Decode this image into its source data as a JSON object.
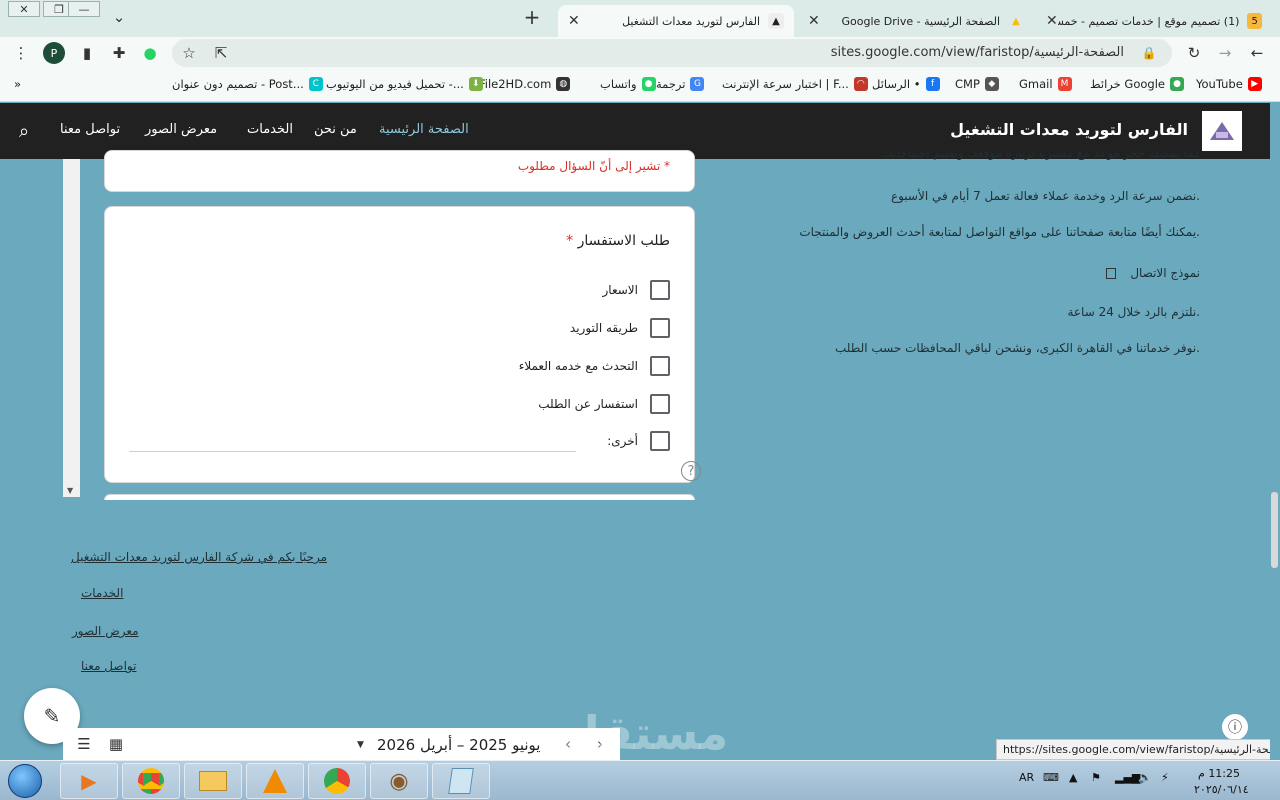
{
  "browser": {
    "tabs": [
      {
        "title": "(1) تصميم موقع | خدمات تصميم - خمسات",
        "icon": "khamsat-icon",
        "active": false
      },
      {
        "title": "الصفحة الرئيسية - Google Drive",
        "icon": "google-drive-icon",
        "active": false
      },
      {
        "title": "الفارس لتوريد معدات التشغيل",
        "icon": "site-favicon",
        "active": true
      }
    ],
    "url": "sites.google.com/view/faristop/الصفحة-الرئيسية",
    "profile_letter": "P",
    "bookmarks": [
      {
        "label": "YouTube",
        "icon": "youtube-icon",
        "color": "#ff0000"
      },
      {
        "label": "خرائط Google",
        "icon": "google-maps-icon",
        "color": "#34a853"
      },
      {
        "label": "Gmail",
        "icon": "gmail-icon",
        "color": "#ea4335"
      },
      {
        "label": "CMP",
        "icon": "cmp-icon",
        "color": "#555555"
      },
      {
        "label": "الرسائل •",
        "icon": "facebook-icon",
        "color": "#1877f2"
      },
      {
        "label": "اختبار سرعة الإنترنت | F...",
        "icon": "speedtest-icon",
        "color": "#c0392b"
      },
      {
        "label": "ترجمة",
        "icon": "google-translate-icon",
        "color": "#4285f4"
      },
      {
        "label": "واتساب",
        "icon": "whatsapp-icon",
        "color": "#25d366"
      },
      {
        "label": "File2HD.com",
        "icon": "globe-icon",
        "color": "#333333"
      },
      {
        "label": "تحميل فيديو من اليوتيوب -...",
        "icon": "download-icon",
        "color": "#7cb342"
      },
      {
        "label": "تصميم دون عنوان - Post...",
        "icon": "canva-icon",
        "color": "#00c4cc"
      }
    ]
  },
  "site": {
    "title": "الفارس لتوريد معدات التشغيل",
    "nav": [
      "الصفحة الرئيسية",
      "من نحن",
      "الخدمات",
      "معرض الصور",
      "تواصل معنا"
    ],
    "active_nav": "الصفحة الرئيسية"
  },
  "form": {
    "required_note": "* تشير إلى أنّ السؤال مطلوب",
    "question": "طلب الاستفسار",
    "required_star": "*",
    "options": [
      "الاسعار",
      "طريقه التوريد",
      "التحدث مع خدمه العملاء",
      "استفسار عن الطلب",
      "أخرى:"
    ]
  },
  "right_text": {
    "line_partial": "كما يمكنك حجز موعد مع مشتريا لزيارة موقعك وتقييم احتياجاتك.",
    "line1": ".نضمن سرعة الرد وخدمة عملاء فعالة تعمل 7 أيام في الأسبوع",
    "line2": ".يمكنك أيضًا متابعة صفحاتنا على مواقع التواصل لمتابعة أحدث العروض والمنتجات",
    "contact_form": "نموذج الاتصال",
    "line3": ".نلتزم بالرد خلال 24 ساعة",
    "line4": ".نوفر خدماتنا في القاهرة الكبرى، ونشحن لباقي المحافظات حسب الطلب"
  },
  "footer_links": [
    "مرحبًا بكم في شركة الفارس لتوريد معدات التشغيل",
    "الخدمات",
    "معرض الصور",
    "تواصل معنا"
  ],
  "calendar": {
    "range": "يونيو 2025 – أبريل 2026"
  },
  "status_url": "https://sites.google.com/view/faristop/الصفحة-الرئيسية",
  "watermark": "مستقل",
  "taskbar": {
    "lang": "AR",
    "time": "11:25 م",
    "date": "٢٠٢٥/٠٦/١٤"
  }
}
